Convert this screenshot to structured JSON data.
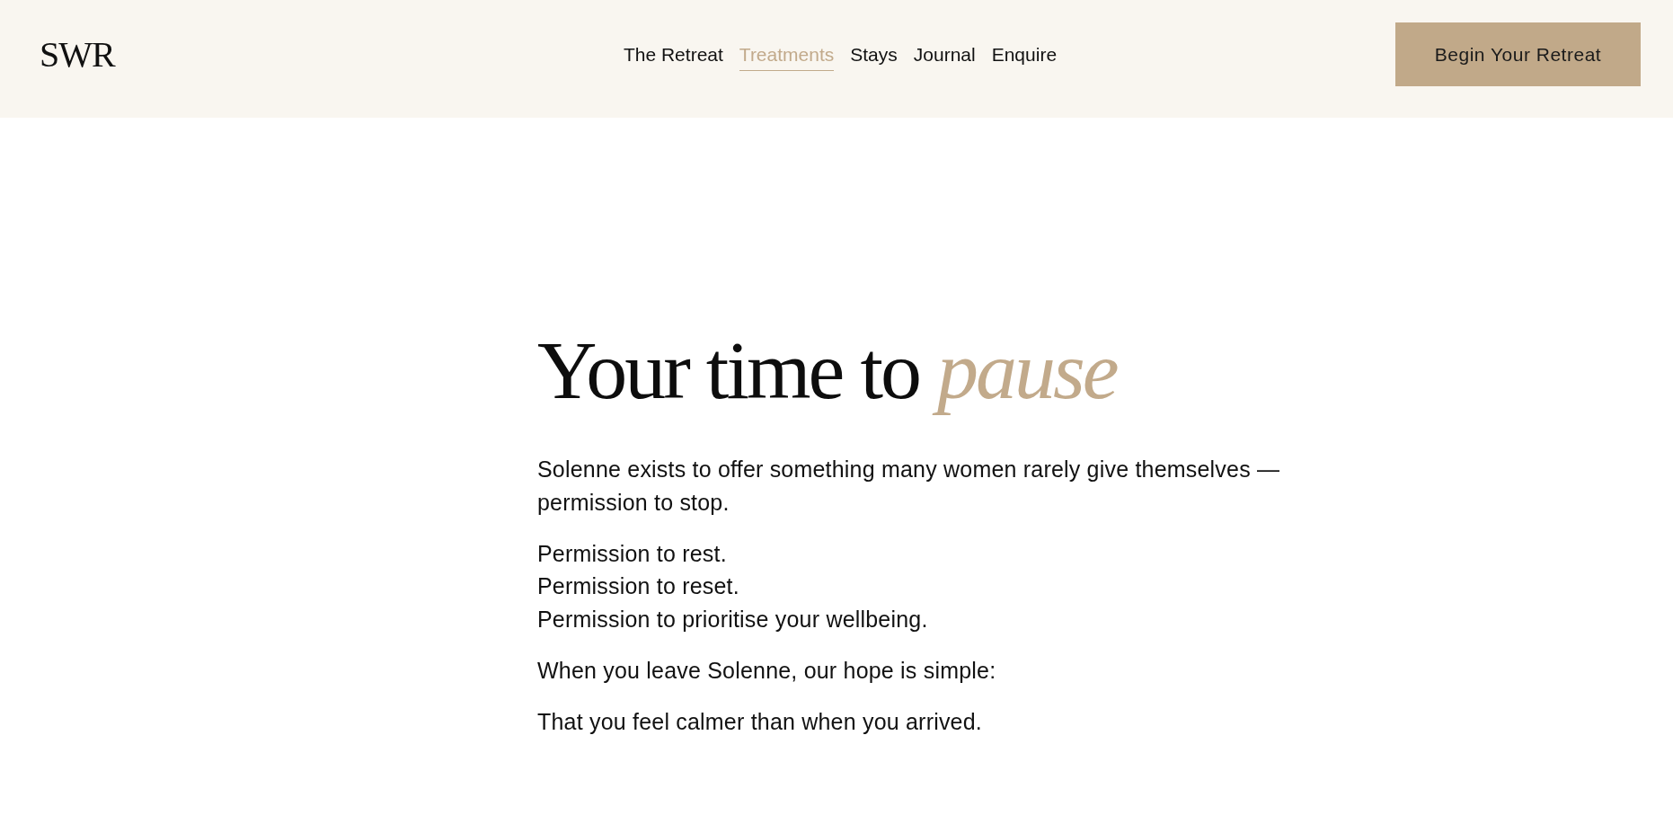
{
  "header": {
    "logo": "SWR",
    "nav": [
      {
        "label": "The Retreat",
        "selected": false
      },
      {
        "label": "Treatments",
        "selected": true
      },
      {
        "label": "Stays",
        "selected": false
      },
      {
        "label": "Journal",
        "selected": false
      },
      {
        "label": "Enquire",
        "selected": false
      }
    ],
    "cta": "Begin Your Retreat"
  },
  "intro": {
    "heading": "Your time to *pause*",
    "paragraphs": [
      {
        "lines": [
          "Solenne exists to offer something many women rarely give themselves — permission to stop."
        ]
      },
      {
        "lines": [
          "Permission to rest.",
          "Permission to reset.",
          "Permission to prioritise your wellbeing."
        ]
      },
      {
        "lines": [
          "When you leave Solenne, our hope is simple:"
        ]
      },
      {
        "lines": [
          "That you feel calmer than when you arrived."
        ]
      }
    ]
  }
}
